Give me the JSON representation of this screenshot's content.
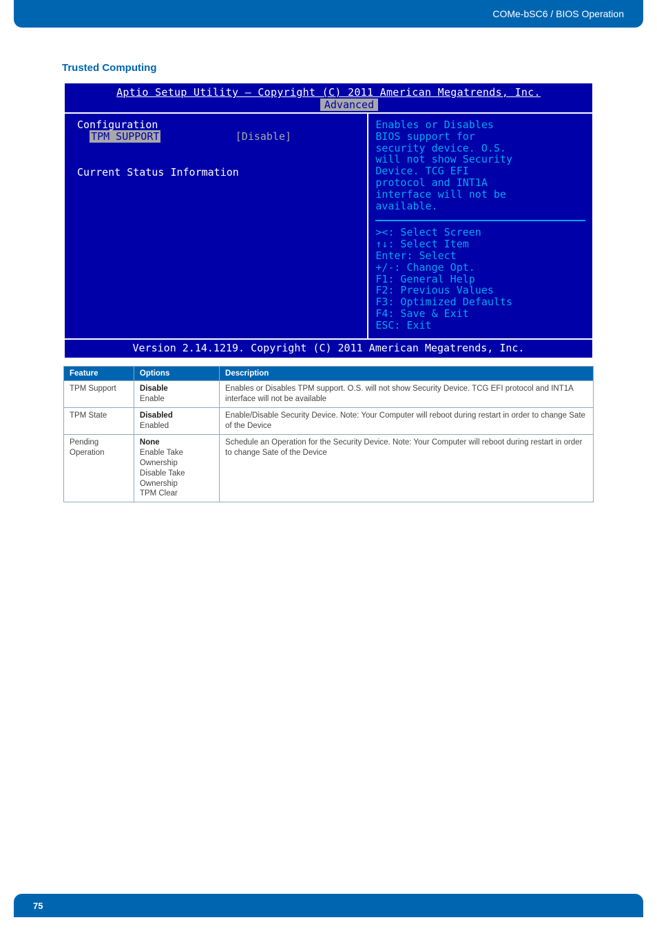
{
  "header": {
    "breadcrumb": "COMe-bSC6 / BIOS Operation"
  },
  "section_title": "Trusted Computing",
  "bios": {
    "title": "Aptio Setup Utility – Copyright (C) 2011 American Megatrends, Inc.",
    "tab": "Advanced",
    "main": {
      "config_label": "Configuration",
      "row_label": "TPM SUPPORT",
      "row_value": "[Disable]",
      "status_label": "Current Status Information"
    },
    "help": {
      "text": "Enables or Disables\nBIOS support for\nsecurity device. O.S.\nwill not show Security\nDevice. TCG EFI\nprotocol and INT1A\ninterface will not be\navailable.",
      "keys": "><: Select Screen\n↑↓: Select Item\nEnter: Select\n+/-: Change Opt.\nF1: General Help\nF2: Previous Values\nF3: Optimized Defaults\nF4: Save & Exit\nESC: Exit"
    },
    "footer": "Version 2.14.1219. Copyright (C) 2011 American Megatrends, Inc."
  },
  "table": {
    "headers": [
      "Feature",
      "Options",
      "Description"
    ],
    "rows": [
      {
        "feature": "TPM Support",
        "default": "Disable",
        "options": [
          "Enable"
        ],
        "description": "Enables or Disables TPM support. O.S. will not show Security Device. TCG EFI protocol and INT1A interface will not be available"
      },
      {
        "feature": "TPM State",
        "default": "Disabled",
        "options": [
          "Enabled"
        ],
        "description": "Enable/Disable Security Device. Note: Your Computer will reboot during restart in order to change Sate of the Device"
      },
      {
        "feature": "Pending Operation",
        "default": "None",
        "options": [
          "Enable Take Ownership",
          "Disable Take Ownership",
          "TPM Clear"
        ],
        "description": "Schedule an Operation for the Security Device. Note: Your Computer will reboot during restart in order to change Sate of the Device"
      }
    ]
  },
  "footer": {
    "page_number": "75"
  }
}
